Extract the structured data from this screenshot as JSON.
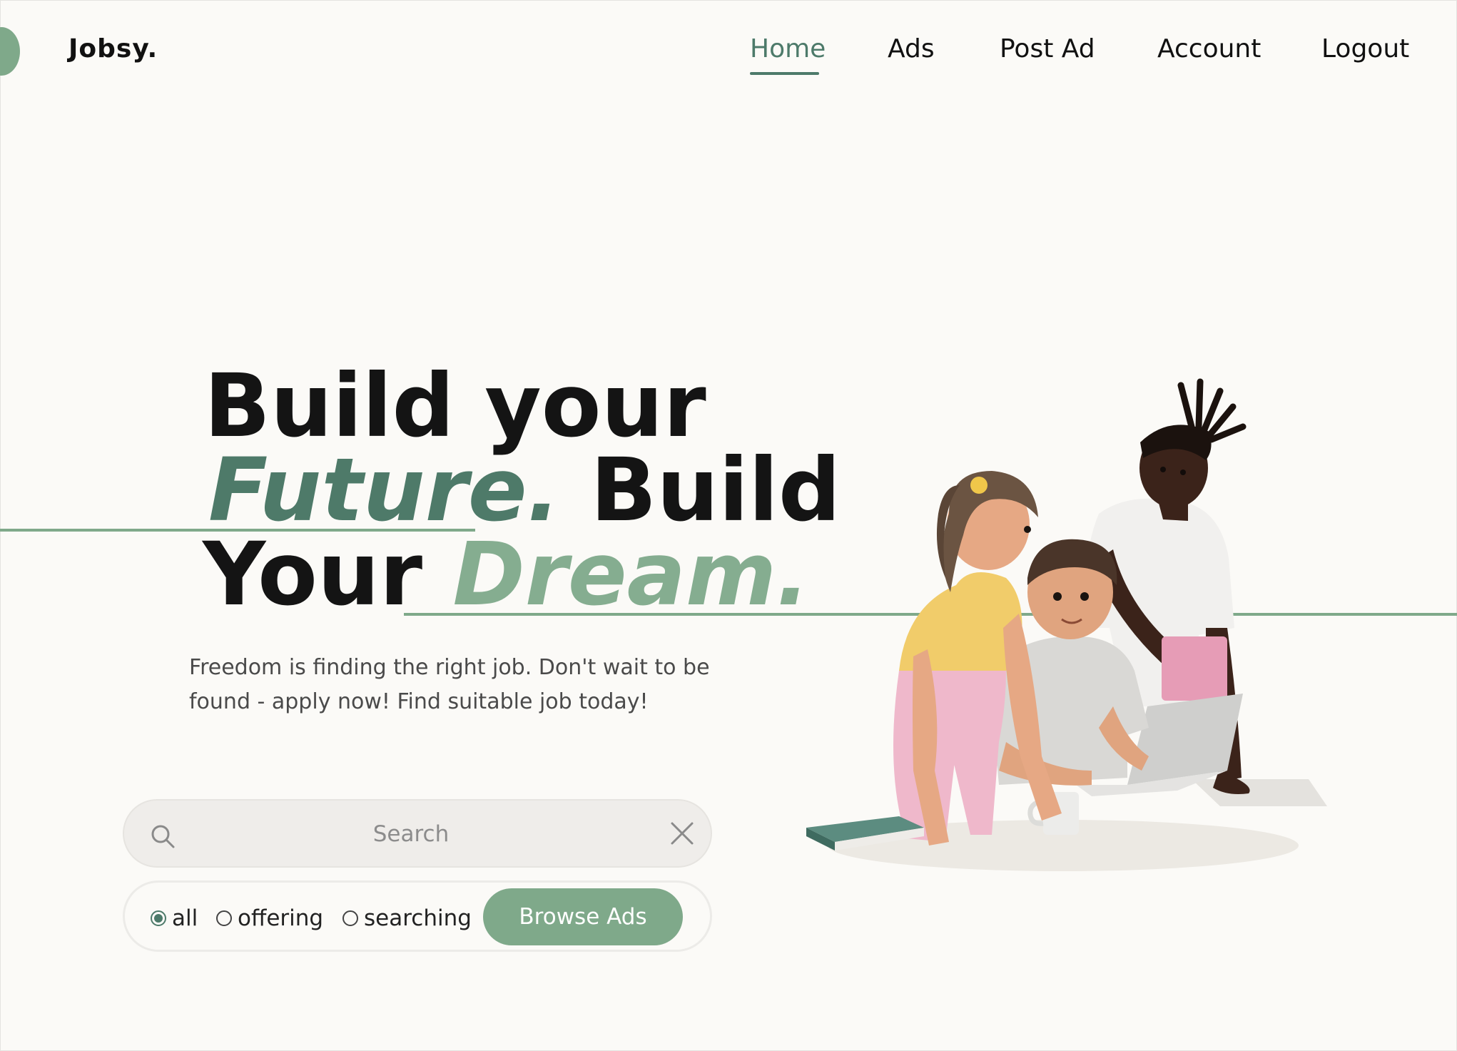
{
  "brand": {
    "name": "Jobsy."
  },
  "nav": {
    "items": [
      {
        "label": "Home",
        "active": true
      },
      {
        "label": "Ads",
        "active": false
      },
      {
        "label": "Post Ad",
        "active": false
      },
      {
        "label": "Account",
        "active": false
      },
      {
        "label": "Logout",
        "active": false
      }
    ]
  },
  "hero": {
    "line1": "Build your",
    "line2_accent": "Future.",
    "line2_rest": " Build",
    "line3_start": "Your ",
    "line3_accent": "Dream.",
    "tagline": "Freedom is finding the right job. Don't wait to be found - apply now! Find suitable job today!"
  },
  "search": {
    "placeholder": "Search",
    "value": "",
    "icon": "search-icon",
    "clear_icon": "close-icon"
  },
  "filters": {
    "options": [
      {
        "label": "all",
        "checked": true
      },
      {
        "label": "offering",
        "checked": false
      },
      {
        "label": "searching",
        "checked": false
      }
    ],
    "browse_label": "Browse Ads"
  },
  "colors": {
    "accent_dark": "#4e7a69",
    "accent_light": "#7fa98a",
    "background": "#fbfaf7"
  }
}
